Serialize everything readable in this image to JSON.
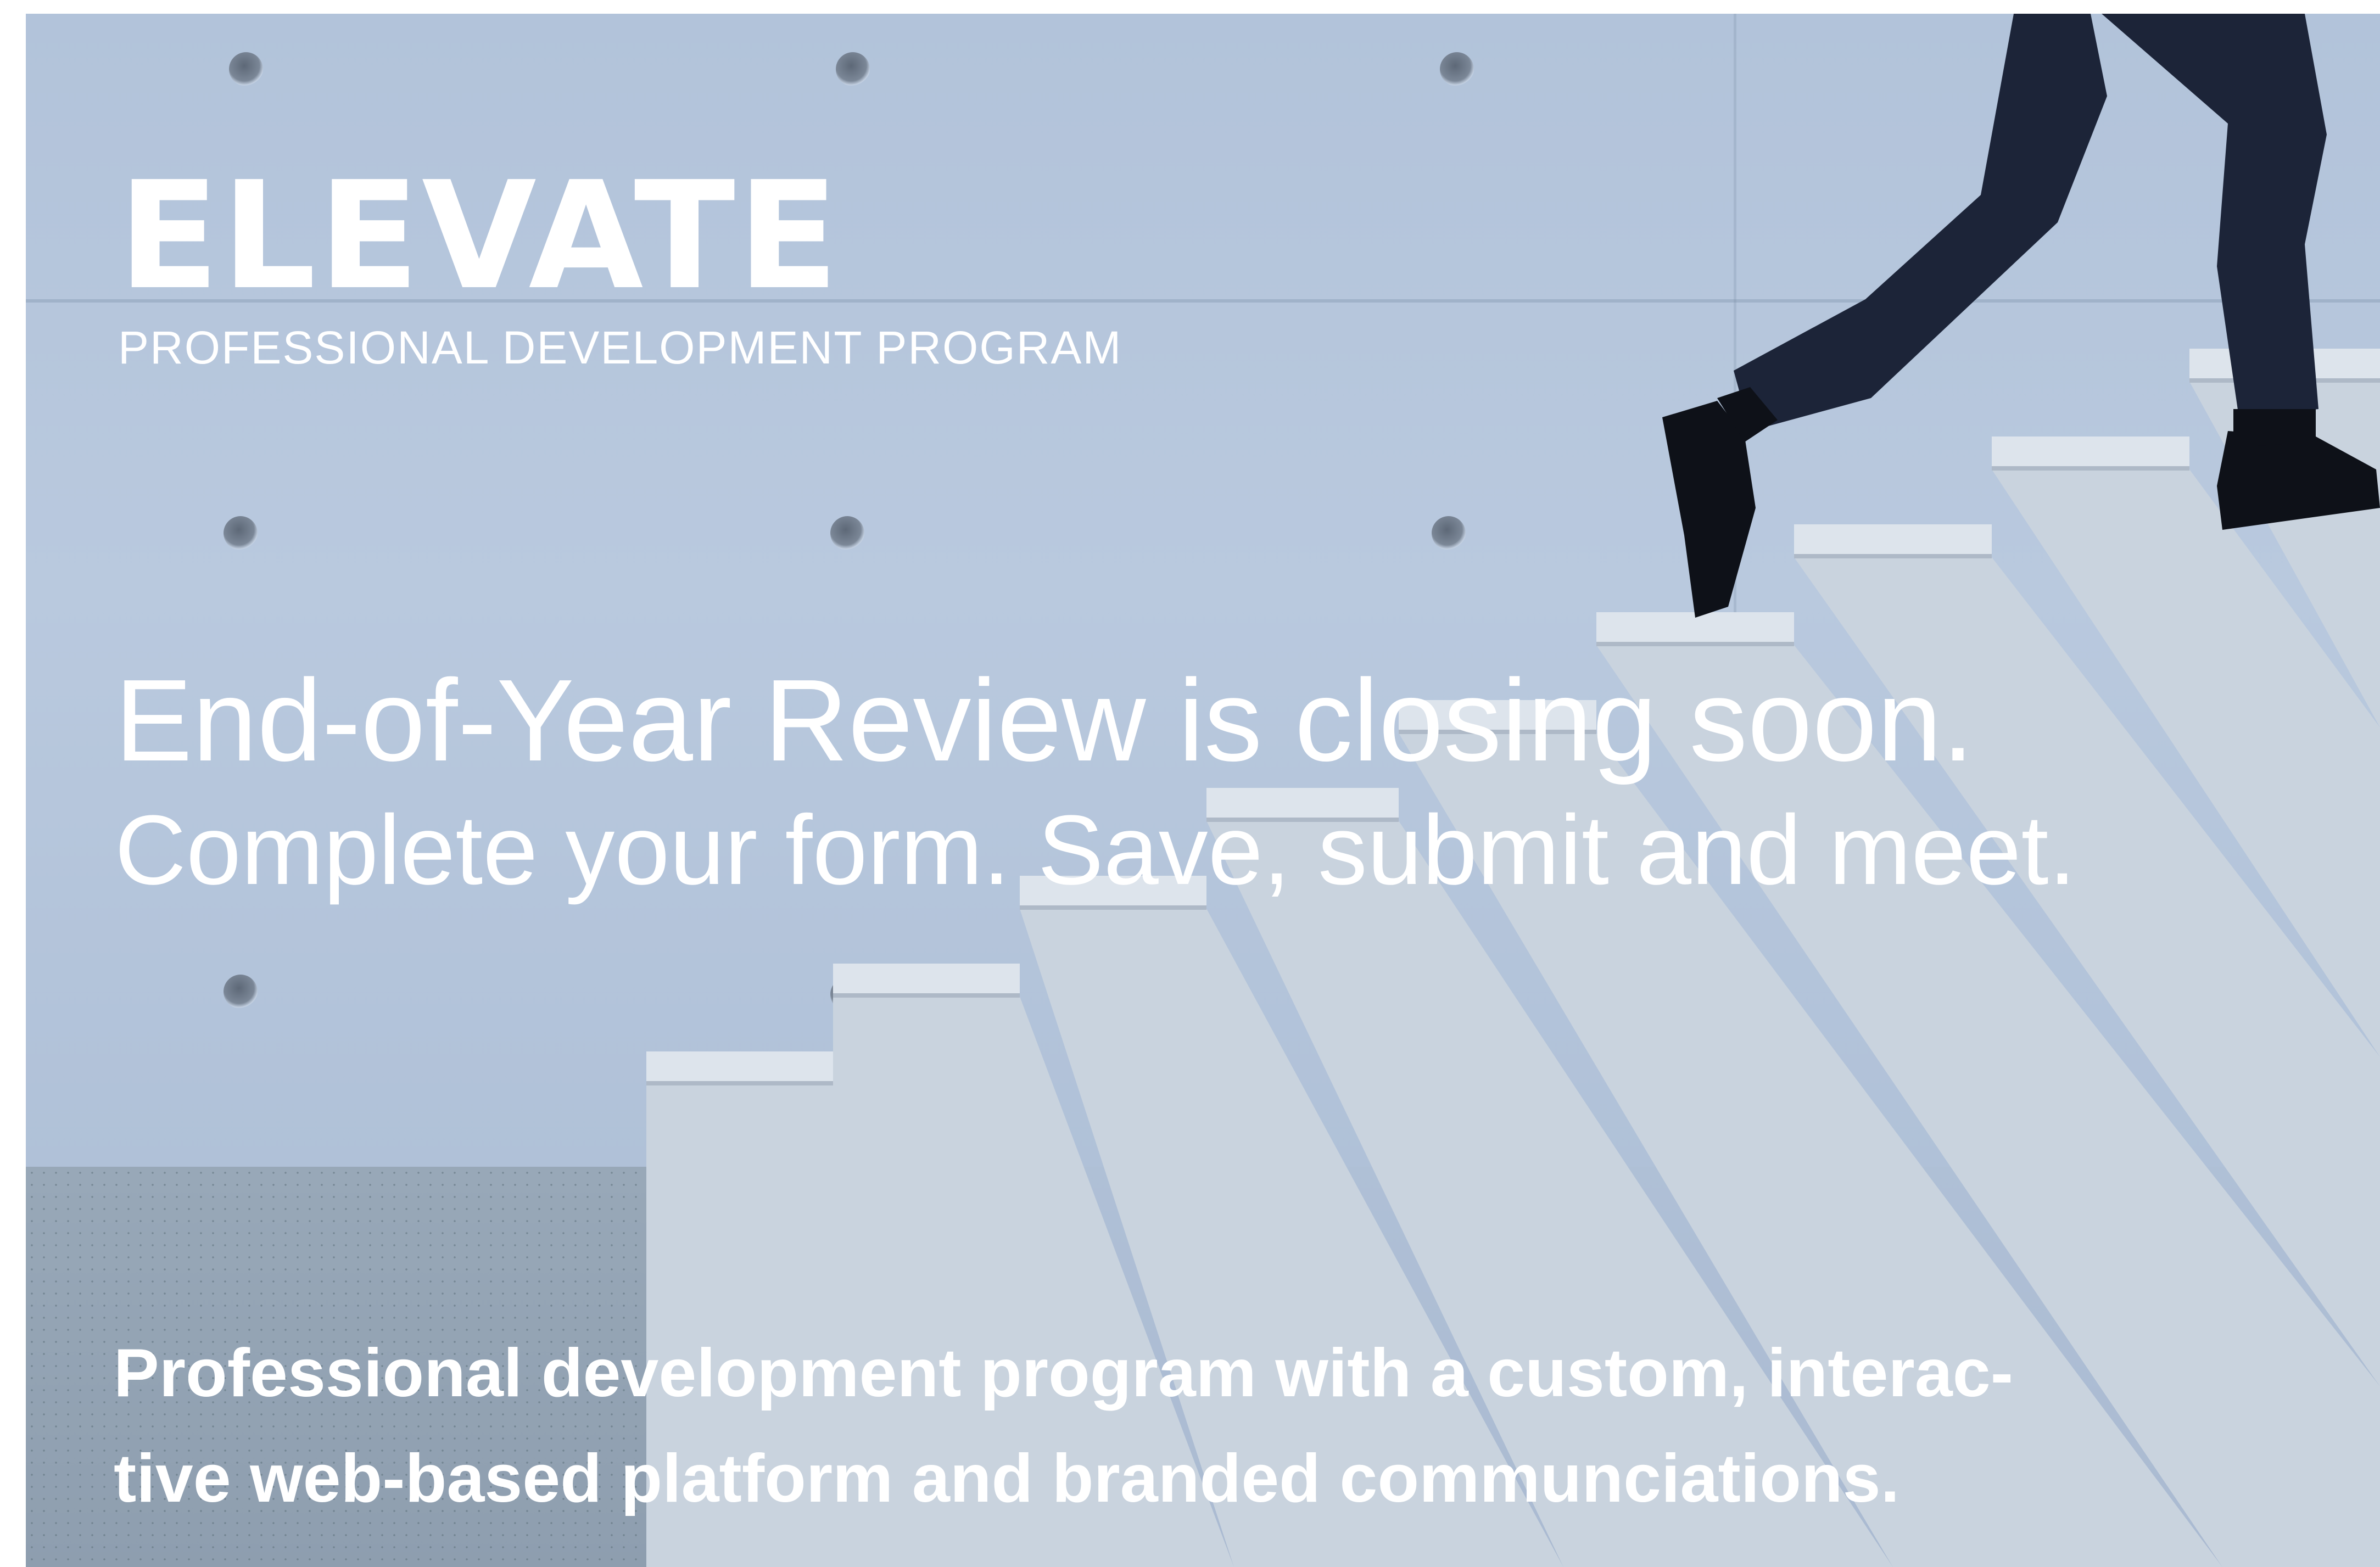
{
  "banner": {
    "logo_text": "ELEVATE",
    "program_subtitle": "PROFESSIONAL DEVELOPMENT PROGRAM",
    "headline": "End-of-Year Review is closing soon.",
    "subheadline": "Complete your form. Save, submit and meet.",
    "tagline_line1": "Professional development program with a custom, interac-",
    "tagline_line2": "tive web-based platform and branded communciations."
  },
  "colors": {
    "text": "#ffffff",
    "wall": "#b5c6dc",
    "stone": "#dde4ec",
    "trousers": "#1c2438"
  },
  "icons": {
    "background_photo": "stairs-runner-photo"
  }
}
